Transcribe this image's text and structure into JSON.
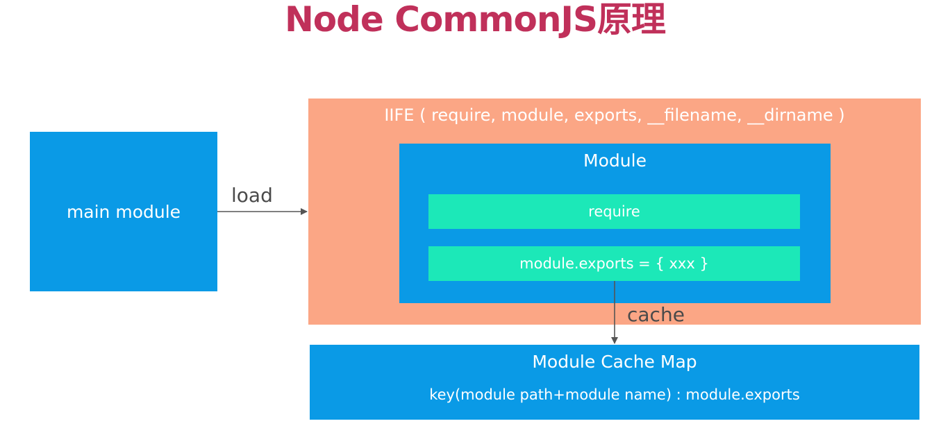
{
  "title": "Node CommonJS原理",
  "main_module": {
    "label": "main module"
  },
  "load_edge": {
    "label": "load"
  },
  "iife": {
    "label": "IIFE ( require, module, exports, __filename, __dirname )"
  },
  "module": {
    "label": "Module",
    "require_label": "require",
    "exports_label": "module.exports = { xxx }"
  },
  "cache_edge": {
    "label": "cache"
  },
  "cache_map": {
    "title": "Module Cache Map",
    "description": "key(module path+module name) : module.exports"
  },
  "colors": {
    "title": "#c0305a",
    "blue": "#0a9ae6",
    "orange": "#fba685",
    "green": "#1ce8b8",
    "arrow": "#555555"
  }
}
